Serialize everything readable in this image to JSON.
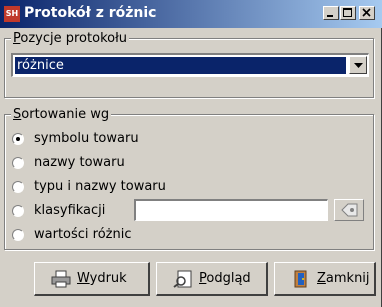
{
  "window": {
    "title": "Protokół z różnic",
    "icon_text": "SH",
    "controls": [
      "minimize",
      "maximize",
      "close"
    ]
  },
  "positions_group": {
    "legend_hotkey": "P",
    "legend_rest": "ozycje protokołu",
    "selected_value": "różnice"
  },
  "sort_group": {
    "legend_hotkey": "S",
    "legend_rest": "ortowanie wg",
    "options": [
      {
        "label": "symbolu towaru",
        "checked": true
      },
      {
        "label": "nazwy towaru",
        "checked": false
      },
      {
        "label": "typu i nazwy towaru",
        "checked": false
      },
      {
        "label": "klasyfikacji",
        "checked": false
      },
      {
        "label": "wartości różnic",
        "checked": false
      }
    ],
    "classification_value": ""
  },
  "buttons": {
    "print": {
      "hotkey": "W",
      "rest": "ydruk",
      "icon": "printer-icon"
    },
    "preview": {
      "hotkey": "P",
      "rest": "odgląd",
      "icon": "preview-icon"
    },
    "close": {
      "hotkey": "Z",
      "rest": "amknij",
      "icon": "exit-door-icon"
    }
  },
  "colors": {
    "title_start": "#0a246a",
    "title_end": "#a6caf0",
    "face": "#d4d0c8",
    "selection": "#0a246a"
  }
}
